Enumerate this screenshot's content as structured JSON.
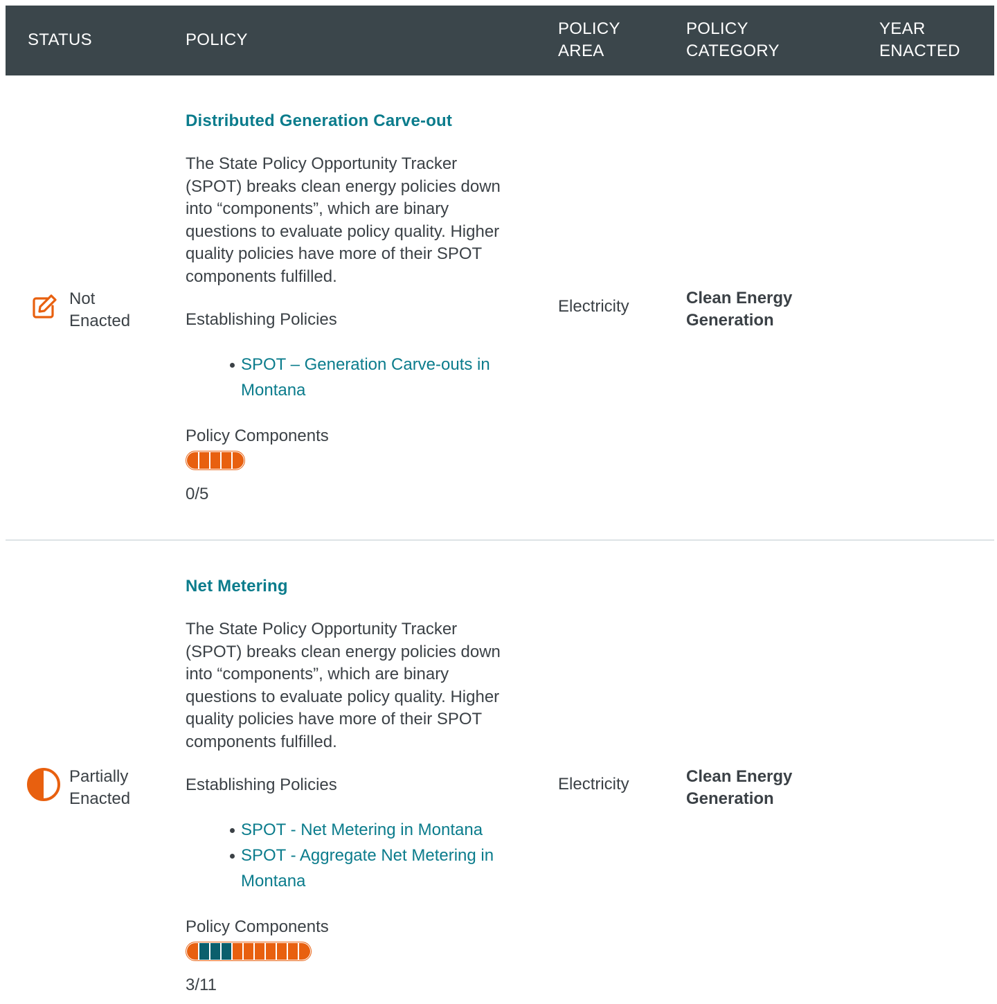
{
  "header": {
    "status": "STATUS",
    "policy": "POLICY",
    "policy_area_1": "POLICY",
    "policy_area_2": "AREA",
    "policy_category_1": "POLICY",
    "policy_category_2": "CATEGORY",
    "year_1": "YEAR",
    "year_2": "ENACTED"
  },
  "colors": {
    "header_bg": "#3b464b",
    "link": "#0b7c8c",
    "accent_orange": "#e8600f",
    "fulfilled_teal": "#0b5f6d"
  },
  "rows": [
    {
      "status_icon": "edit-pencil-icon",
      "status_line1": "Not",
      "status_line2": "Enacted",
      "title": "Distributed Generation Carve-out",
      "description": "The State Policy Opportunity Tracker (SPOT) breaks clean energy policies down into “components”, which are binary questions to evaluate policy quality. Higher quality policies have more of their SPOT components fulfilled.",
      "establishing_label": "Establishing Policies",
      "links": [
        "SPOT – Generation Carve-outs in Montana"
      ],
      "components_label": "Policy Components",
      "components_fulfilled": 0,
      "components_total": 5,
      "count_text": "0/5",
      "area": "Electricity",
      "category": "Clean Energy Generation",
      "year": ""
    },
    {
      "status_icon": "half-circle-icon",
      "status_line1": "Partially",
      "status_line2": "Enacted",
      "title": "Net Metering",
      "description": "The State Policy Opportunity Tracker (SPOT) breaks clean energy policies down into “components”, which are binary questions to evaluate policy quality. Higher quality policies have more of their SPOT components fulfilled.",
      "establishing_label": "Establishing Policies",
      "links": [
        "SPOT - Net Metering in Montana",
        "SPOT - Aggregate Net Metering in Montana"
      ],
      "components_label": "Policy Components",
      "components_fulfilled": 3,
      "components_total": 11,
      "count_text": "3/11",
      "area": "Electricity",
      "category": "Clean Energy Generation",
      "year": ""
    }
  ]
}
